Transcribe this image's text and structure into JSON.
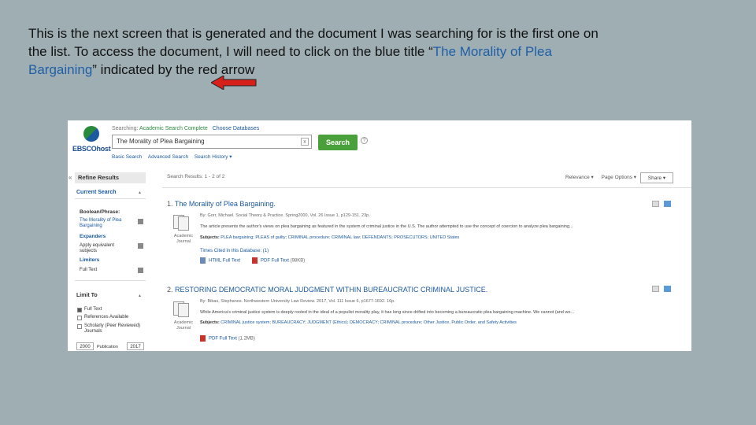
{
  "caption": {
    "line1": "This is the next screen that is generated and the document I was searching for is the first one on",
    "line2_pre": "the list.  To access the document, I will need to click on the blue title “",
    "line2_blue": "The Morality of Plea",
    "line3_blue": "Bargaining",
    "line3_post": "” indicated by the red arrow"
  },
  "header": {
    "logo": "EBSCOhost",
    "searching_label": "Searching:",
    "database": "Academic Search Complete",
    "choose_db": "Choose Databases",
    "search_value": "The Morality of Plea Bargaining",
    "clear_symbol": "x",
    "search_button": "Search",
    "help_symbol": "?",
    "links": [
      "Basic Search",
      "Advanced Search",
      "Search History ▾"
    ]
  },
  "sidebar": {
    "collapse_symbol": "«",
    "refine_title": "Refine Results",
    "current_search": "Current Search",
    "boolean_label": "Boolean/Phrase:",
    "boolean_value": "The Morality of Plea Bargaining",
    "expanders_label": "Expanders",
    "expander_value": "Apply equivalent subjects",
    "limiters_label": "Limiters",
    "limiter_value": "Full Text",
    "limit_to": "Limit To",
    "options": [
      {
        "label": "Full Text",
        "checked": true
      },
      {
        "label": "References Available",
        "checked": false
      },
      {
        "label": "Scholarly (Peer Reviewed) Journals",
        "checked": false
      }
    ],
    "year_from": "2000",
    "publication_label": "Publication",
    "year_to": "2017"
  },
  "results_bar": {
    "summary": "Search Results: 1 - 2 of 2",
    "relevance": "Relevance ▾",
    "page_options": "Page Options ▾",
    "share": "Share ▾"
  },
  "results": [
    {
      "number": "1.",
      "title": "The Morality of Plea Bargaining.",
      "meta": "By: Gorr, Michael. Social Theory & Practice. Spring2000, Vol. 26 Issue 1, p129-151. 23p.",
      "abstract": "The article presents the author's views on plea bargaining as featured in the system of criminal justice in the U.S. The author attempted to use the concept of coercion to analyze plea bargaining...",
      "subjects_label": "Subjects:",
      "subjects": "PLEA bargaining; PLEAS of guilty; CRIMINAL procedure; CRIMINAL law; DEFENDANTS; PROSECUTORS; UNITED States",
      "type": "Academic Journal",
      "cited": "Times Cited in this Database: (1)",
      "fulltext": [
        {
          "label": "HTML Full Text",
          "size": ""
        },
        {
          "label": "PDF Full Text",
          "size": "(98KB)"
        }
      ]
    },
    {
      "number": "2.",
      "title": "RESTORING DEMOCRATIC MORAL JUDGMENT WITHIN BUREAUCRATIC CRIMINAL JUSTICE.",
      "meta": "By: Bibas, Stephanos. Northwestern University Law Review. 2017, Vol. 111 Issue 6, p1677-1692. 16p.",
      "abstract": "While America's criminal justice system is deeply rooted in the ideal of a populist morality play, it has long since drifted into becoming a bureaucratic plea bargaining machine. We cannot (and wo...",
      "subjects_label": "Subjects:",
      "subjects": "CRIMINAL justice system; BUREAUCRACY; JUDGMENT (Ethics); DEMOCRACY; CRIMINAL procedure; Other Justice, Public Order, and Safety Activities",
      "type": "Academic Journal",
      "cited": "",
      "fulltext": [
        {
          "label": "PDF Full Text",
          "size": "(1.2MB)"
        }
      ]
    }
  ],
  "colors": {
    "background": "#9faeb3",
    "link_blue": "#1c5aa0",
    "search_green": "#4aa03a",
    "arrow_red": "#d8201a"
  }
}
